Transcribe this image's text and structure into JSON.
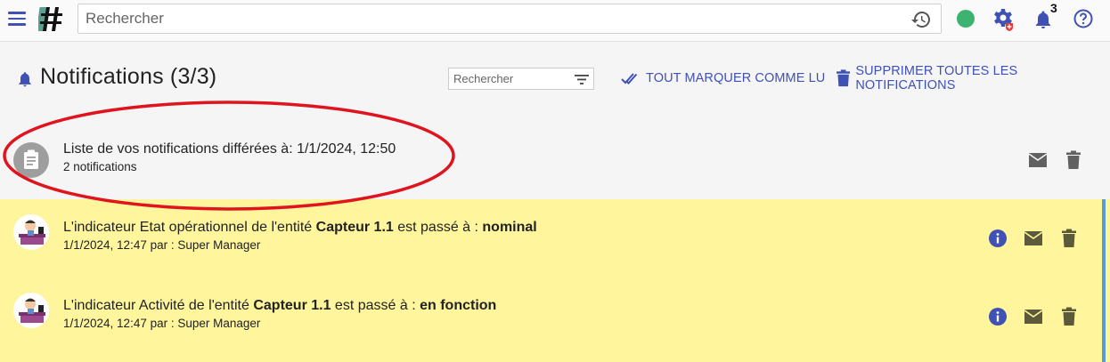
{
  "topbar": {
    "search_placeholder": "Rechercher",
    "notification_count": "3"
  },
  "header": {
    "title": "Notifications (3/3)",
    "filter_placeholder": "Rechercher",
    "mark_all_read": "TOUT MARQUER COMME LU",
    "delete_all": "SUPPRIMER TOUTES LES NOTIFICATIONS"
  },
  "deferred": {
    "title": "Liste de vos notifications différées à: 1/1/2024, 12:50",
    "subtitle": "2 notifications"
  },
  "notifications": [
    {
      "prefix": "L'indicateur Etat opérationnel de l'entité ",
      "entity": "Capteur 1.1",
      "middle": " est passé à : ",
      "value": "nominal",
      "meta": "1/1/2024, 12:47 par : Super Manager"
    },
    {
      "prefix": "L'indicateur Activité de l'entité ",
      "entity": "Capteur 1.1",
      "middle": " est passé à : ",
      "value": "en fonction",
      "meta": "1/1/2024, 12:47 par : Super Manager"
    }
  ],
  "colors": {
    "accent": "#3f51b5",
    "status_online": "#3cb371",
    "highlight_row": "#fff59d",
    "annotation": "#e0141e"
  }
}
